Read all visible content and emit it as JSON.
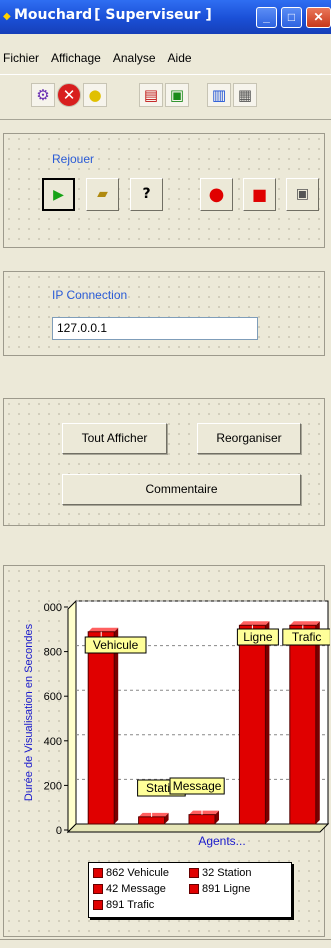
{
  "window": {
    "app_title": "Mouchard",
    "subtitle": "[ Superviseur ]",
    "app_icon": "app-icon"
  },
  "menu": [
    "Fichier",
    "Affichage",
    "Analyse",
    "Aide"
  ],
  "toolbar_icons": [
    "settings-gear-icon",
    "stop-red-x-icon",
    "lightbulb-icon",
    "report-icon",
    "monitor-green-icon",
    "chart-icon",
    "grid-icon"
  ],
  "replay_panel": {
    "label": "Rejouer",
    "buttons": [
      "play-icon",
      "open-folder-icon",
      "help-question-icon",
      "record-icon",
      "stop-icon",
      "save-disk-icon"
    ],
    "help_label": "?"
  },
  "ip_panel": {
    "label": "IP Connection",
    "value": "127.0.0.1"
  },
  "actions": {
    "show_all": "Tout Afficher",
    "reorganize": "Reorganiser",
    "comment": "Commentaire"
  },
  "chart_data": {
    "type": "bar",
    "categories": [
      "Vehicule",
      "Station",
      "Message",
      "Ligne",
      "Trafic"
    ],
    "values": [
      862,
      32,
      42,
      891,
      891
    ],
    "callout_labels": [
      "Vehicule",
      "Statio",
      "Message",
      "Ligne",
      "Trafic"
    ],
    "ylabel": "Durée de Visualisation en Secondes",
    "xlabel": "Agents...",
    "ylim": [
      0,
      1000
    ],
    "yticks": [
      "0",
      "200",
      "400",
      "600",
      "800",
      "000"
    ],
    "grid": true,
    "bar_color": "#e00000",
    "legend": {
      "position": "bottom",
      "entries": [
        "862 Vehicule",
        "32 Station",
        "42 Message",
        "891 Ligne",
        "891 Trafic"
      ]
    }
  }
}
